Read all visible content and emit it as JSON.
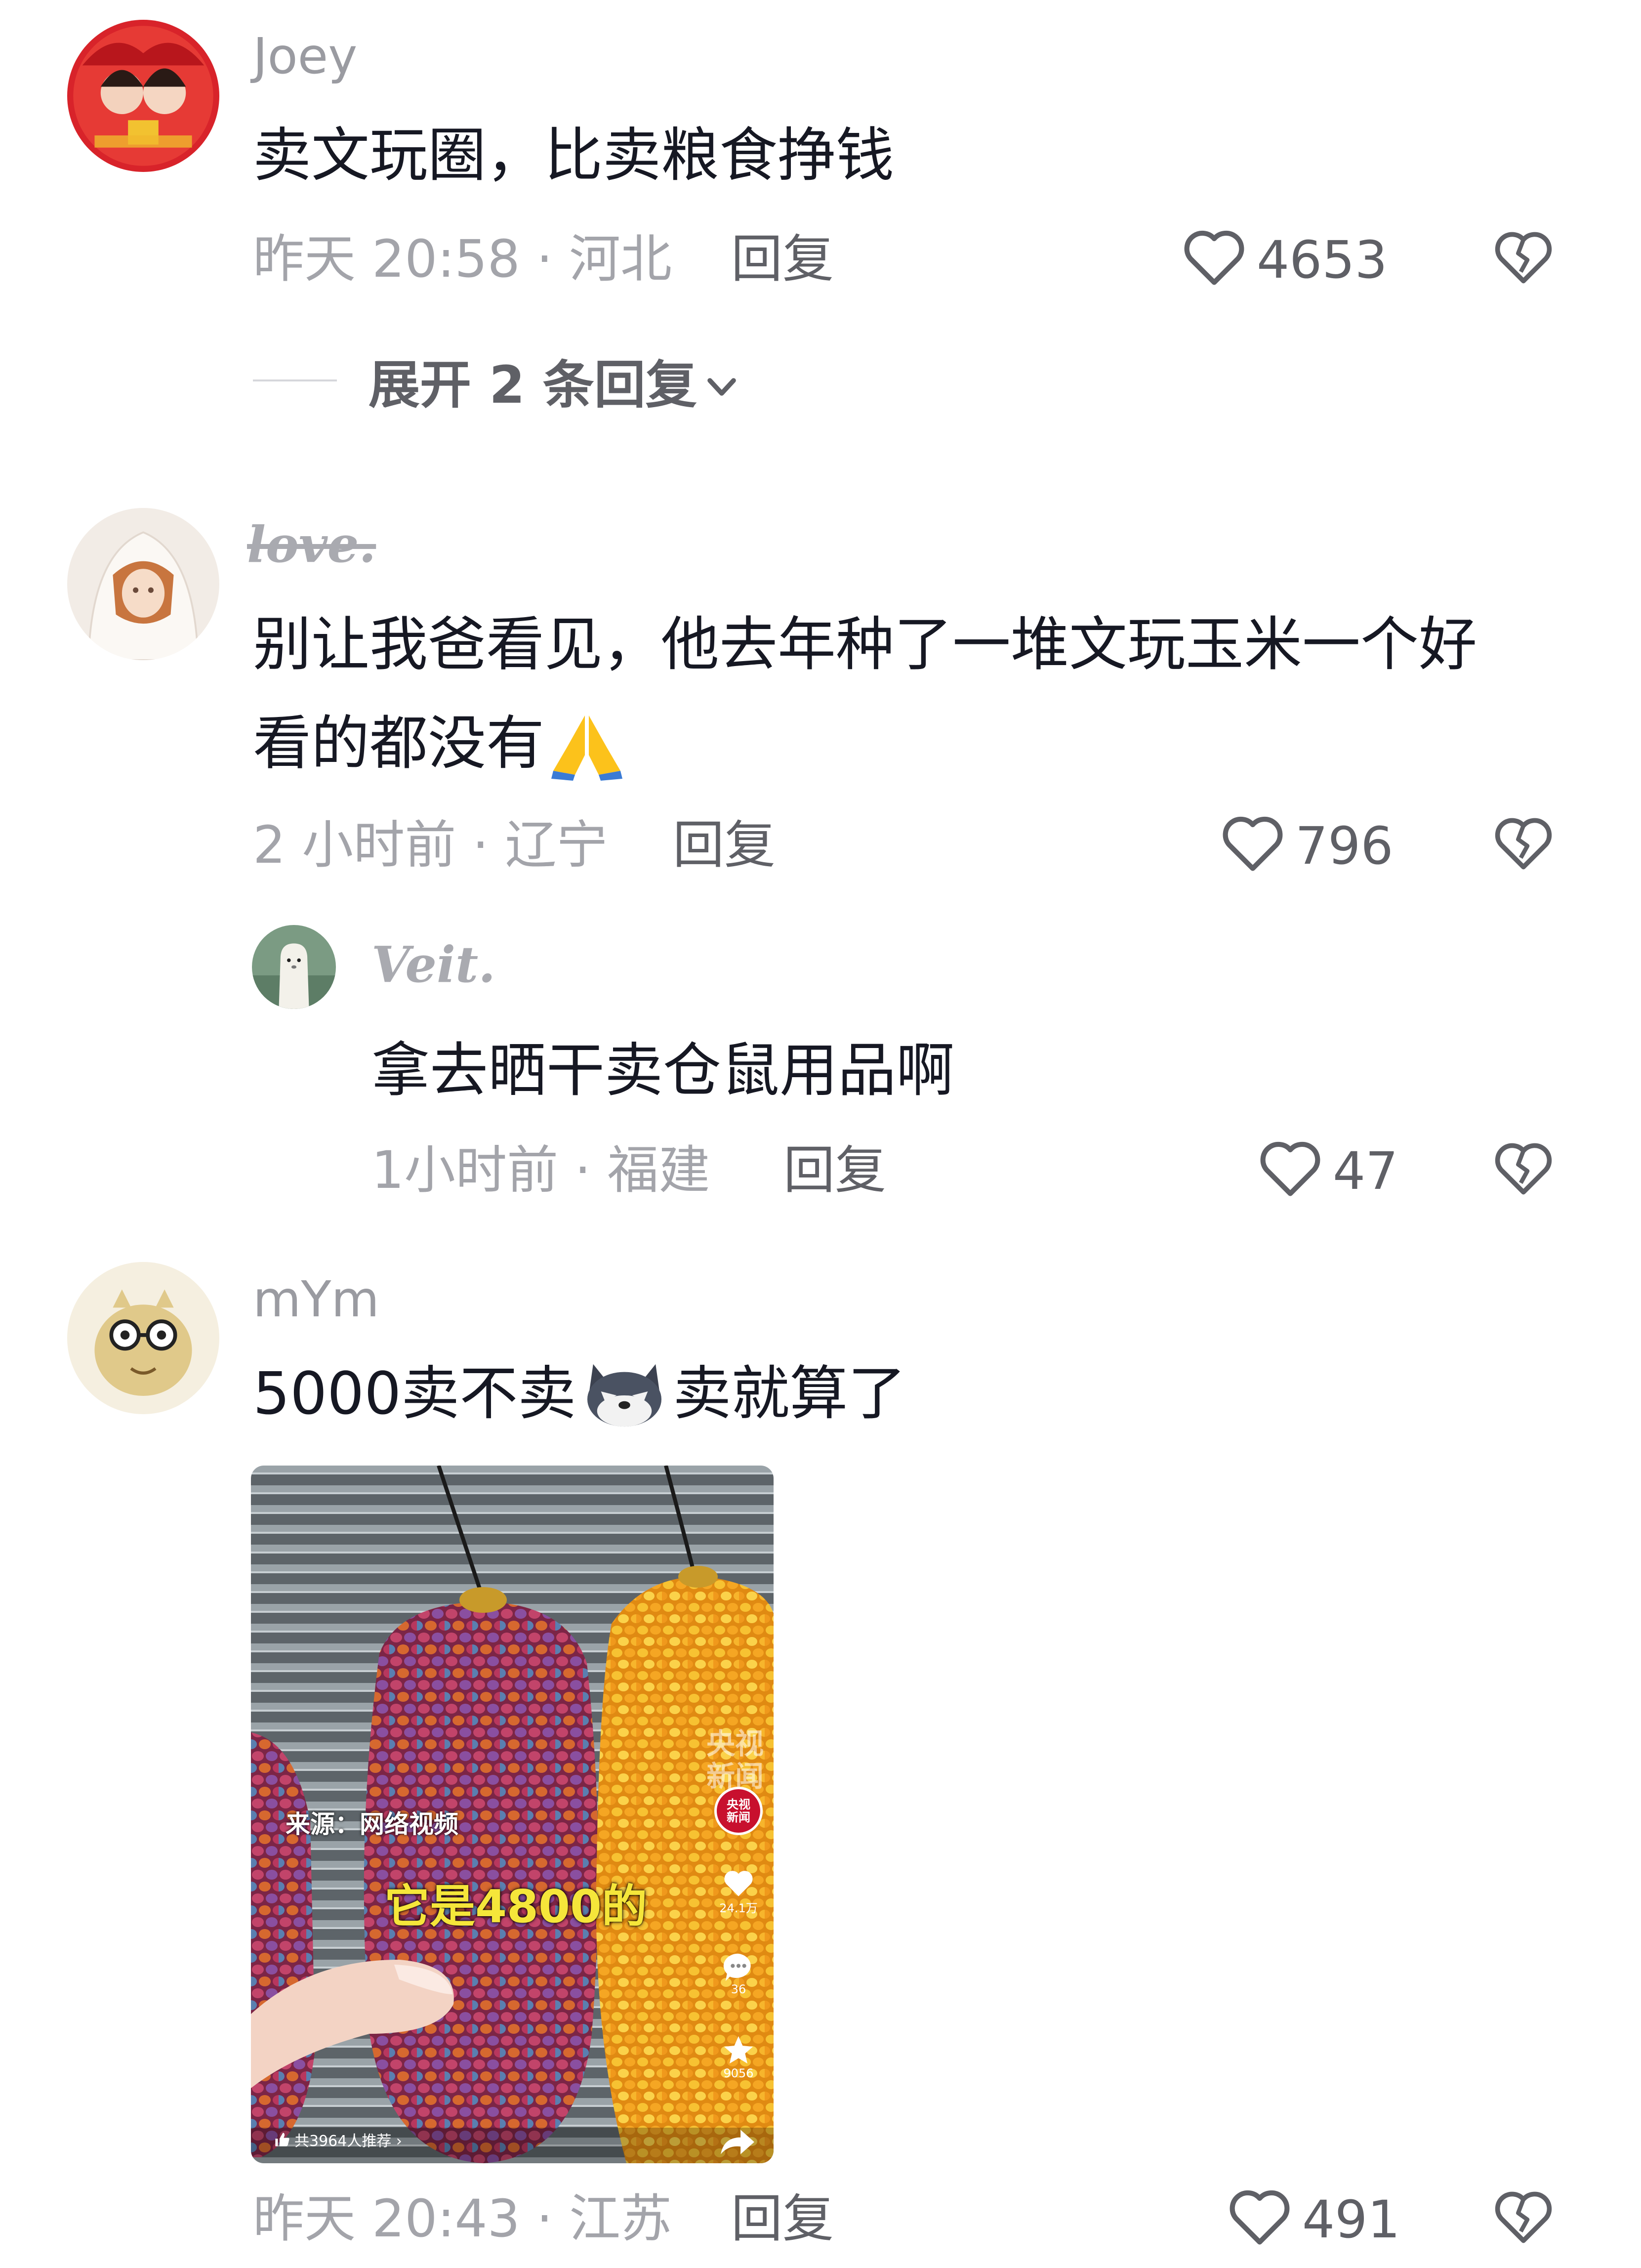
{
  "comments": [
    {
      "user": "Joey",
      "text": "卖文玩圈，比卖粮食挣钱",
      "meta": "昨天 20:58 · 河北",
      "reply_label": "回复",
      "likes": "4653",
      "expand_label": "展开 2 条回复"
    },
    {
      "user": "love.",
      "text_line1": "别让我爸看见，他去年种了一堆文玩玉米一个好",
      "text_line2": "看的都没有",
      "meta": "2 小时前 · 辽宁",
      "reply_label": "回复",
      "likes": "796",
      "replies": [
        {
          "user": "Veit.",
          "text": "拿去晒干卖仓鼠用品啊",
          "meta": "1小时前 · 福建",
          "reply_label": "回复",
          "likes": "47"
        }
      ]
    },
    {
      "user": "mYm",
      "text_before": "5000卖不卖",
      "text_after": "卖就算了",
      "meta": "昨天 20:43 · 江苏",
      "reply_label": "回复",
      "likes": "491",
      "video": {
        "source_caption": "来源：网络视频",
        "subtitle": "它是4800的",
        "watermark_line1": "央视",
        "watermark_line2": "新闻",
        "badge_line1": "央视",
        "badge_line2": "新闻",
        "likes": "24.1万",
        "comments": "36",
        "favorites": "9056",
        "recommend": "共3964人推荐 ›"
      }
    }
  ],
  "colors": {
    "username": "#9a9ba1",
    "body_text": "#161823",
    "meta": "#a3a4aa",
    "action": "#5f6066"
  },
  "icons": [
    "heart-outline-icon",
    "broken-heart-icon",
    "chevron-down-icon",
    "folded-hands-emoji",
    "wolf-face-emoji"
  ]
}
